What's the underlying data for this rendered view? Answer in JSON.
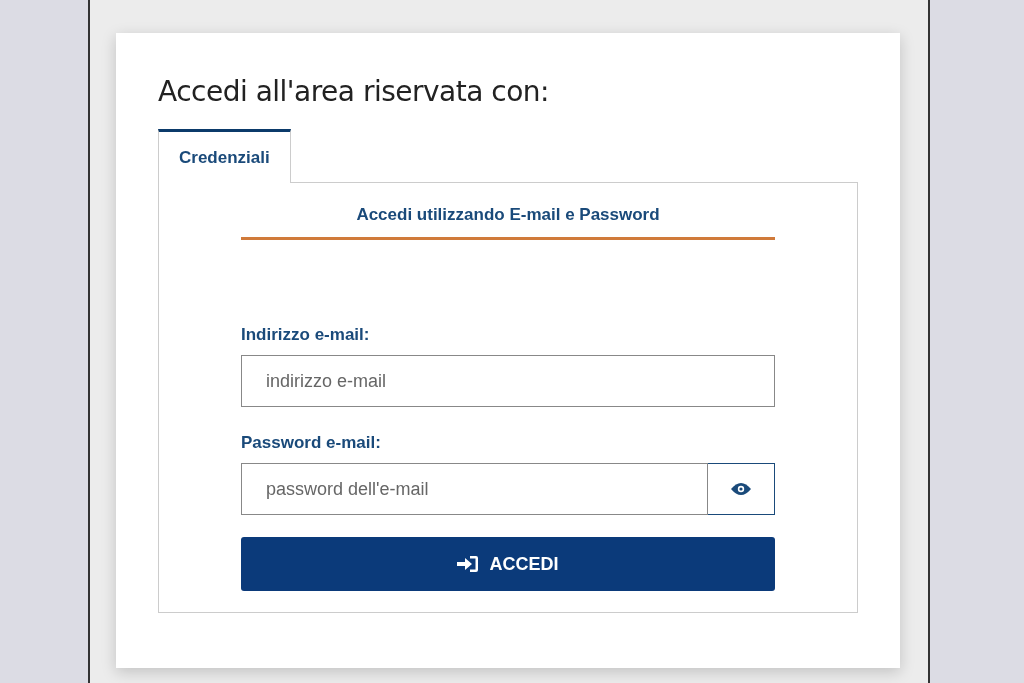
{
  "title": "Accedi all'area riservata con:",
  "tabs": [
    {
      "label": "Credenziali",
      "selected": true
    }
  ],
  "subtitle": "Accedi utilizzando E-mail e Password",
  "fields": [
    {
      "kind": "email",
      "label": "Indirizzo e-mail:",
      "placeholder": "indirizzo e-mail"
    },
    {
      "kind": "password",
      "label": "Password e-mail:",
      "placeholder": "password dell'e-mail"
    }
  ],
  "submit": {
    "label": "ACCEDI"
  }
}
